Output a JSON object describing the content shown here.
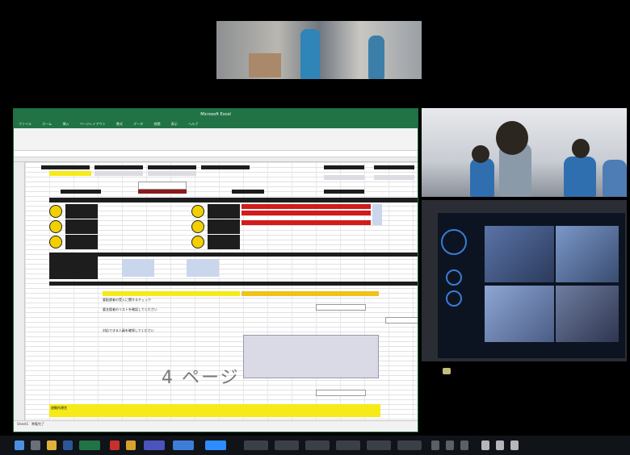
{
  "excel": {
    "window_title": "Microsoft Excel",
    "menu": [
      "ファイル",
      "ホーム",
      "挿入",
      "ページレイアウト",
      "数式",
      "データ",
      "校閲",
      "表示",
      "ヘルプ"
    ],
    "page_overlay": "4 ページ",
    "sheet_tabs": [
      "Sheet1"
    ],
    "status_text": "準備完了"
  },
  "panels": {
    "left_header": "要配慮者の受入に関するチェック",
    "instruction_1": "要支援者のリストを確認してください",
    "instruction_2": "対応できる人員を確保してください",
    "bottom_label": "避難所運営"
  },
  "taskbar": {
    "start_label": "スタート",
    "tray_time": "",
    "apps": [
      "Excel",
      "Teams",
      "Chrome",
      "Edge",
      "Explorer",
      "Zoom",
      "Outlook",
      "Word"
    ]
  },
  "colors": {
    "excel_green": "#217346",
    "alert_red": "#d21b1b",
    "highlight_yellow": "#f6ea18"
  }
}
